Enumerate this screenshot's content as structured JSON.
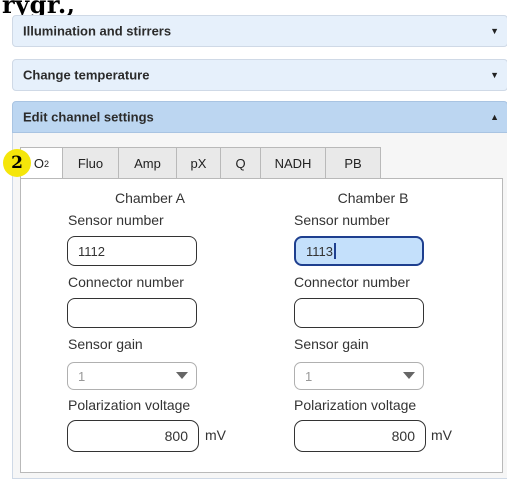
{
  "top_heading": "rygr.,",
  "accordions": [
    {
      "label": "Illumination and stirrers",
      "expanded": false
    },
    {
      "label": "Change temperature",
      "expanded": false
    },
    {
      "label": "Edit channel settings",
      "expanded": true
    }
  ],
  "badge": "2",
  "tabs": [
    {
      "label": "O",
      "sub": "2",
      "active": true
    },
    {
      "label": "Fluo"
    },
    {
      "label": "Amp"
    },
    {
      "label": "pX"
    },
    {
      "label": "Q"
    },
    {
      "label": "NADH"
    },
    {
      "label": "PB"
    }
  ],
  "chamber_a": {
    "title": "Chamber A",
    "sensor_label": "Sensor number",
    "sensor_value": "1112",
    "connector_label": "Connector number",
    "connector_value": "",
    "gain_label": "Sensor gain",
    "gain_value": "1",
    "polar_label": "Polarization voltage",
    "polar_value": "800",
    "unit": "mV"
  },
  "chamber_b": {
    "title": "Chamber B",
    "sensor_label": "Sensor number",
    "sensor_value": "1113",
    "connector_label": "Connector number",
    "connector_value": "",
    "gain_label": "Sensor gain",
    "gain_value": "1",
    "polar_label": "Polarization voltage",
    "polar_value": "800",
    "unit": "mV"
  },
  "colors": {
    "accordion_bg": "#e6f0fb",
    "accordion_active_bg": "#bcd6f1",
    "badge": "#f5e60a",
    "active_input_bg": "#c4e0fb"
  }
}
